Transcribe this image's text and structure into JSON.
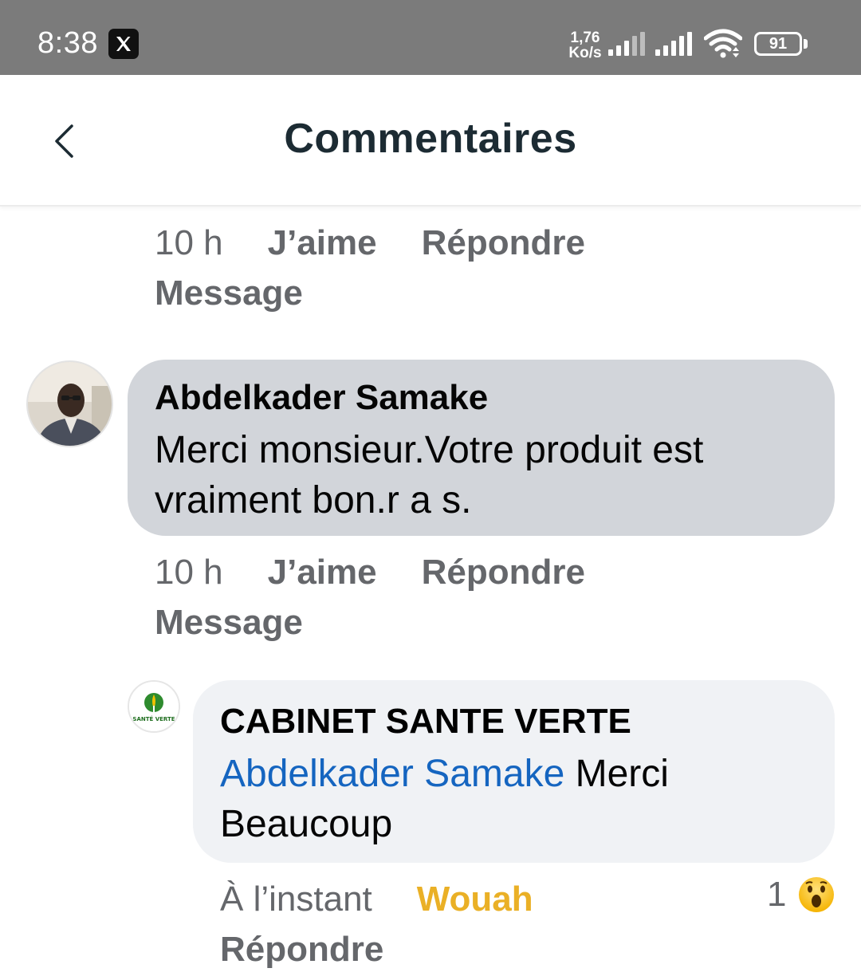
{
  "status_bar": {
    "time": "8:38",
    "notification_icon": "x-app-icon",
    "net_speed_value": "1,76",
    "net_speed_unit": "Ko/s",
    "battery": "91"
  },
  "header": {
    "title": "Commentaires",
    "back_icon": "chevron-left-icon"
  },
  "comments": [
    {
      "timestamp": "10 h",
      "like_label": "J’aime",
      "reply_label": "Répondre",
      "message_label": "Message"
    },
    {
      "author": "Abdelkader Samake",
      "text_line1": "Merci monsieur.Votre produit est",
      "text_line2": "vraiment bon.r a s.",
      "timestamp": "10 h",
      "like_label": "J’aime",
      "reply_label": "Répondre",
      "message_label": "Message"
    },
    {
      "author": "CABINET SANTE VERTE",
      "avatar_text": "SANTÉ VERTE",
      "mention": "Abdelkader Samake",
      "text_after_mention": " Merci",
      "text_line2": "Beaucoup",
      "timestamp": "À l’instant",
      "reaction_label": "Wouah",
      "reply_label": "Répondre",
      "reaction_count": "1",
      "reaction_icon": "wow-emoji-icon"
    }
  ],
  "colors": {
    "status_bar": "#7b7b7b",
    "title": "#1c2b33",
    "meta": "#65676b",
    "mention": "#1565c0",
    "wouah": "#eab026",
    "bubble_1": "#d2d5da",
    "bubble_2": "#f0f2f5"
  }
}
